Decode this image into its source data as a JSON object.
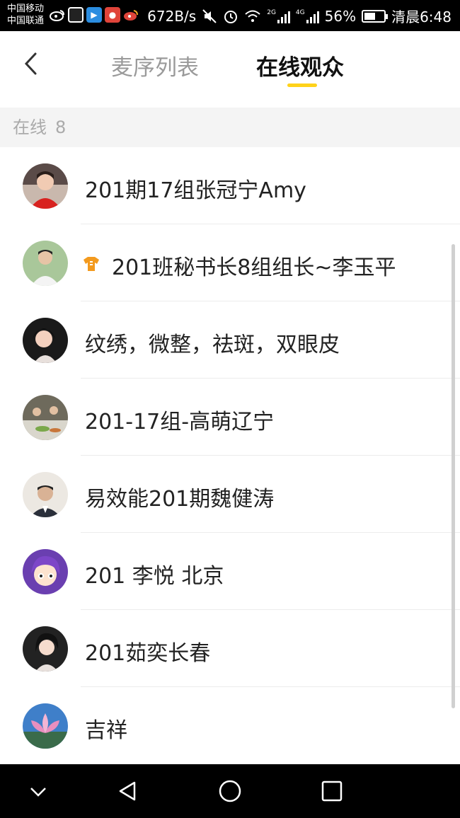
{
  "status_bar": {
    "carrier_1": "中国移动",
    "carrier_2": "中国联通",
    "net_speed": "672B/s",
    "battery": "56%",
    "battery_level": 0.56,
    "time": "清晨6:48",
    "net_type_1": "2G",
    "net_type_2": "4G"
  },
  "header": {
    "tab_queue": "麦序列表",
    "tab_online": "在线观众",
    "active_tab": "在线观众",
    "accent_color": "#ffd21a"
  },
  "section": {
    "label": "在线",
    "count": "8"
  },
  "audience": [
    {
      "name": "201期17组张冠宁Amy",
      "avatar": "woman-portrait-red"
    },
    {
      "name": "201班秘书长8组组长~李玉平",
      "avatar": "man-portrait-white-shirt",
      "badge": "shirt-badge-icon"
    },
    {
      "name": "纹绣，微整，祛斑，双眼皮",
      "avatar": "woman-portrait-dark"
    },
    {
      "name": "201-17组-高萌辽宁",
      "avatar": "group-dinner-photo"
    },
    {
      "name": "易效能201期魏健涛",
      "avatar": "man-portrait-suit"
    },
    {
      "name": "201 李悦 北京",
      "avatar": "anime-character-purple"
    },
    {
      "name": "201茹奕长春",
      "avatar": "woman-portrait-black"
    },
    {
      "name": "吉祥",
      "avatar": "lotus-flower"
    }
  ]
}
